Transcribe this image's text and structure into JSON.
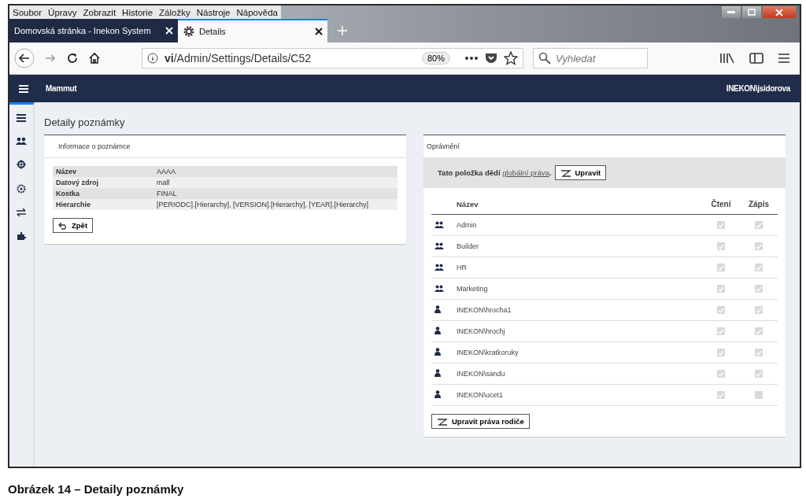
{
  "menu_bar": [
    "Soubor",
    "Úpravy",
    "Zobrazit",
    "Historie",
    "Záložky",
    "Nástroje",
    "Nápověda"
  ],
  "tabs": [
    {
      "label": "Domovská stránka - Inekon System",
      "selected": false
    },
    {
      "label": "Details",
      "selected": true
    }
  ],
  "address_bar": {
    "url_host": "vi",
    "url_path": "/Admin/Settings/Details/C52",
    "zoom": "80%"
  },
  "search": {
    "placeholder": "Vyhledat"
  },
  "app_header": {
    "title": "Mammut",
    "user": "INEKON\\jsidorova"
  },
  "page_title": "Detaily poznámky",
  "info_panel": {
    "title": "Informace o poznámce",
    "rows": [
      {
        "label": "Název",
        "value": "AAAA"
      },
      {
        "label": "Datový zdroj",
        "value": "mall"
      },
      {
        "label": "Kostka",
        "value": "FINAL"
      },
      {
        "label": "Hierarchie",
        "value": "[PERIODC].[Hierarchy], [VERSION].[Hierarchy], [YEAR].[Hierarchy]"
      }
    ],
    "back_button": "Zpět"
  },
  "permissions_panel": {
    "title": "Oprávnění",
    "inherit_text": "Tato položka dědí",
    "inherit_link": "globální práva",
    "inherit_dot": ".",
    "edit_button": "Upravit",
    "columns": [
      "Název",
      "Čtení",
      "Zápis"
    ],
    "rows": [
      {
        "kind": "group",
        "name": "Admin",
        "read": true,
        "write": true
      },
      {
        "kind": "group",
        "name": "Builder",
        "read": true,
        "write": true
      },
      {
        "kind": "group",
        "name": "HR",
        "read": true,
        "write": true
      },
      {
        "kind": "group",
        "name": "Marketing",
        "read": true,
        "write": true
      },
      {
        "kind": "user",
        "name": "INEKON\\hrocha1",
        "read": true,
        "write": true
      },
      {
        "kind": "user",
        "name": "INEKON\\hrochj",
        "read": true,
        "write": true
      },
      {
        "kind": "user",
        "name": "INEKON\\kratkoruky",
        "read": true,
        "write": true
      },
      {
        "kind": "user",
        "name": "INEKON\\sandu",
        "read": true,
        "write": true
      },
      {
        "kind": "user",
        "name": "INEKON\\ucet1",
        "read": true,
        "write": false
      }
    ],
    "parent_button": "Upravit práva rodiče"
  },
  "caption": "Obrázek 14 – Detaily poznámky"
}
